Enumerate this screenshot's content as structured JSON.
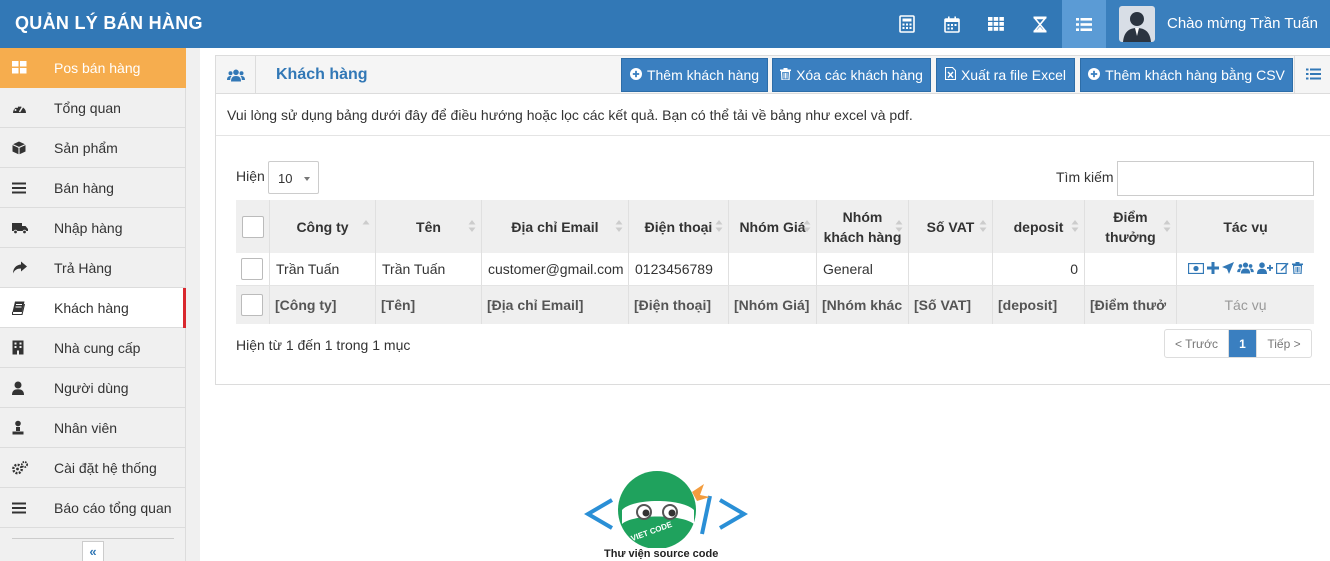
{
  "header": {
    "brand": "QUẢN LÝ BÁN HÀNG",
    "icons": [
      "calculator-icon",
      "calendar-icon",
      "grid-icon",
      "hourglass-icon",
      "list-icon"
    ],
    "welcome": "Chào mừng Trần Tuấn"
  },
  "sidebar": {
    "items": [
      {
        "label": "Pos bán hàng",
        "icon": "pos-grid-icon"
      },
      {
        "label": "Tổng quan",
        "icon": "dashboard-icon"
      },
      {
        "label": "Sản phẩm",
        "icon": "box-icon"
      },
      {
        "label": "Bán hàng",
        "icon": "bars-icon"
      },
      {
        "label": "Nhập hàng",
        "icon": "truck-icon"
      },
      {
        "label": "Trả Hàng",
        "icon": "share-arrow-icon"
      },
      {
        "label": "Khách hàng",
        "icon": "book-icon"
      },
      {
        "label": "Nhà cung cấp",
        "icon": "building-icon"
      },
      {
        "label": "Người dùng",
        "icon": "user-icon"
      },
      {
        "label": "Nhân viên",
        "icon": "employee-icon"
      },
      {
        "label": "Cài đặt hệ thống",
        "icon": "cogs-icon"
      },
      {
        "label": "Báo cáo tổng quan",
        "icon": "bars-icon"
      }
    ],
    "collapse": "«"
  },
  "panel": {
    "title": "Khách hàng",
    "buttons": {
      "add": "Thêm khách hàng",
      "delete": "Xóa các khách hàng",
      "export": "Xuất ra file Excel",
      "import_csv": "Thêm khách hàng bằng CSV"
    },
    "intro": "Vui lòng sử dụng bảng dưới đây để điều hướng hoặc lọc các kết quả. Bạn có thể tải về bảng như excel và pdf."
  },
  "table_controls": {
    "length_label": "Hiện",
    "length_value": "10",
    "search_label": "Tìm kiếm",
    "search_value": ""
  },
  "table": {
    "headers": [
      "Công ty",
      "Tên",
      "Địa chỉ Email",
      "Điện thoại",
      "Nhóm Giá",
      "Nhóm khách hàng",
      "Số VAT",
      "deposit",
      "Điểm thưởng",
      "Tác vụ"
    ],
    "rows": [
      {
        "company": "Trần Tuấn",
        "name": "Trần Tuấn",
        "email": "customer@gmail.com",
        "phone": "0123456789",
        "price_group": "",
        "customer_group": "General",
        "vat": "",
        "deposit": "0",
        "points": ""
      }
    ],
    "filters": [
      "[Công ty]",
      "[Tên]",
      "[Địa chỉ Email]",
      "[Điện thoại]",
      "[Nhóm Giá]",
      "[Nhóm khác",
      "[Số VAT]",
      "[deposit]",
      "[Điểm thưở",
      "Tác vụ"
    ]
  },
  "footer": {
    "info": "Hiện từ 1 đến 1 trong 1 mục",
    "prev": "< Trước",
    "page": "1",
    "next": "Tiếp >"
  },
  "logo": {
    "brand": "VIET CODE",
    "caption": "Thư viện source code"
  },
  "colors": {
    "header": "#3278b6",
    "accent_orange": "#f6ad4e",
    "active_marker": "#d9282e",
    "button": "#3a7fc0",
    "logo_green": "#1fa25d",
    "logo_blue": "#2a8fd6"
  }
}
